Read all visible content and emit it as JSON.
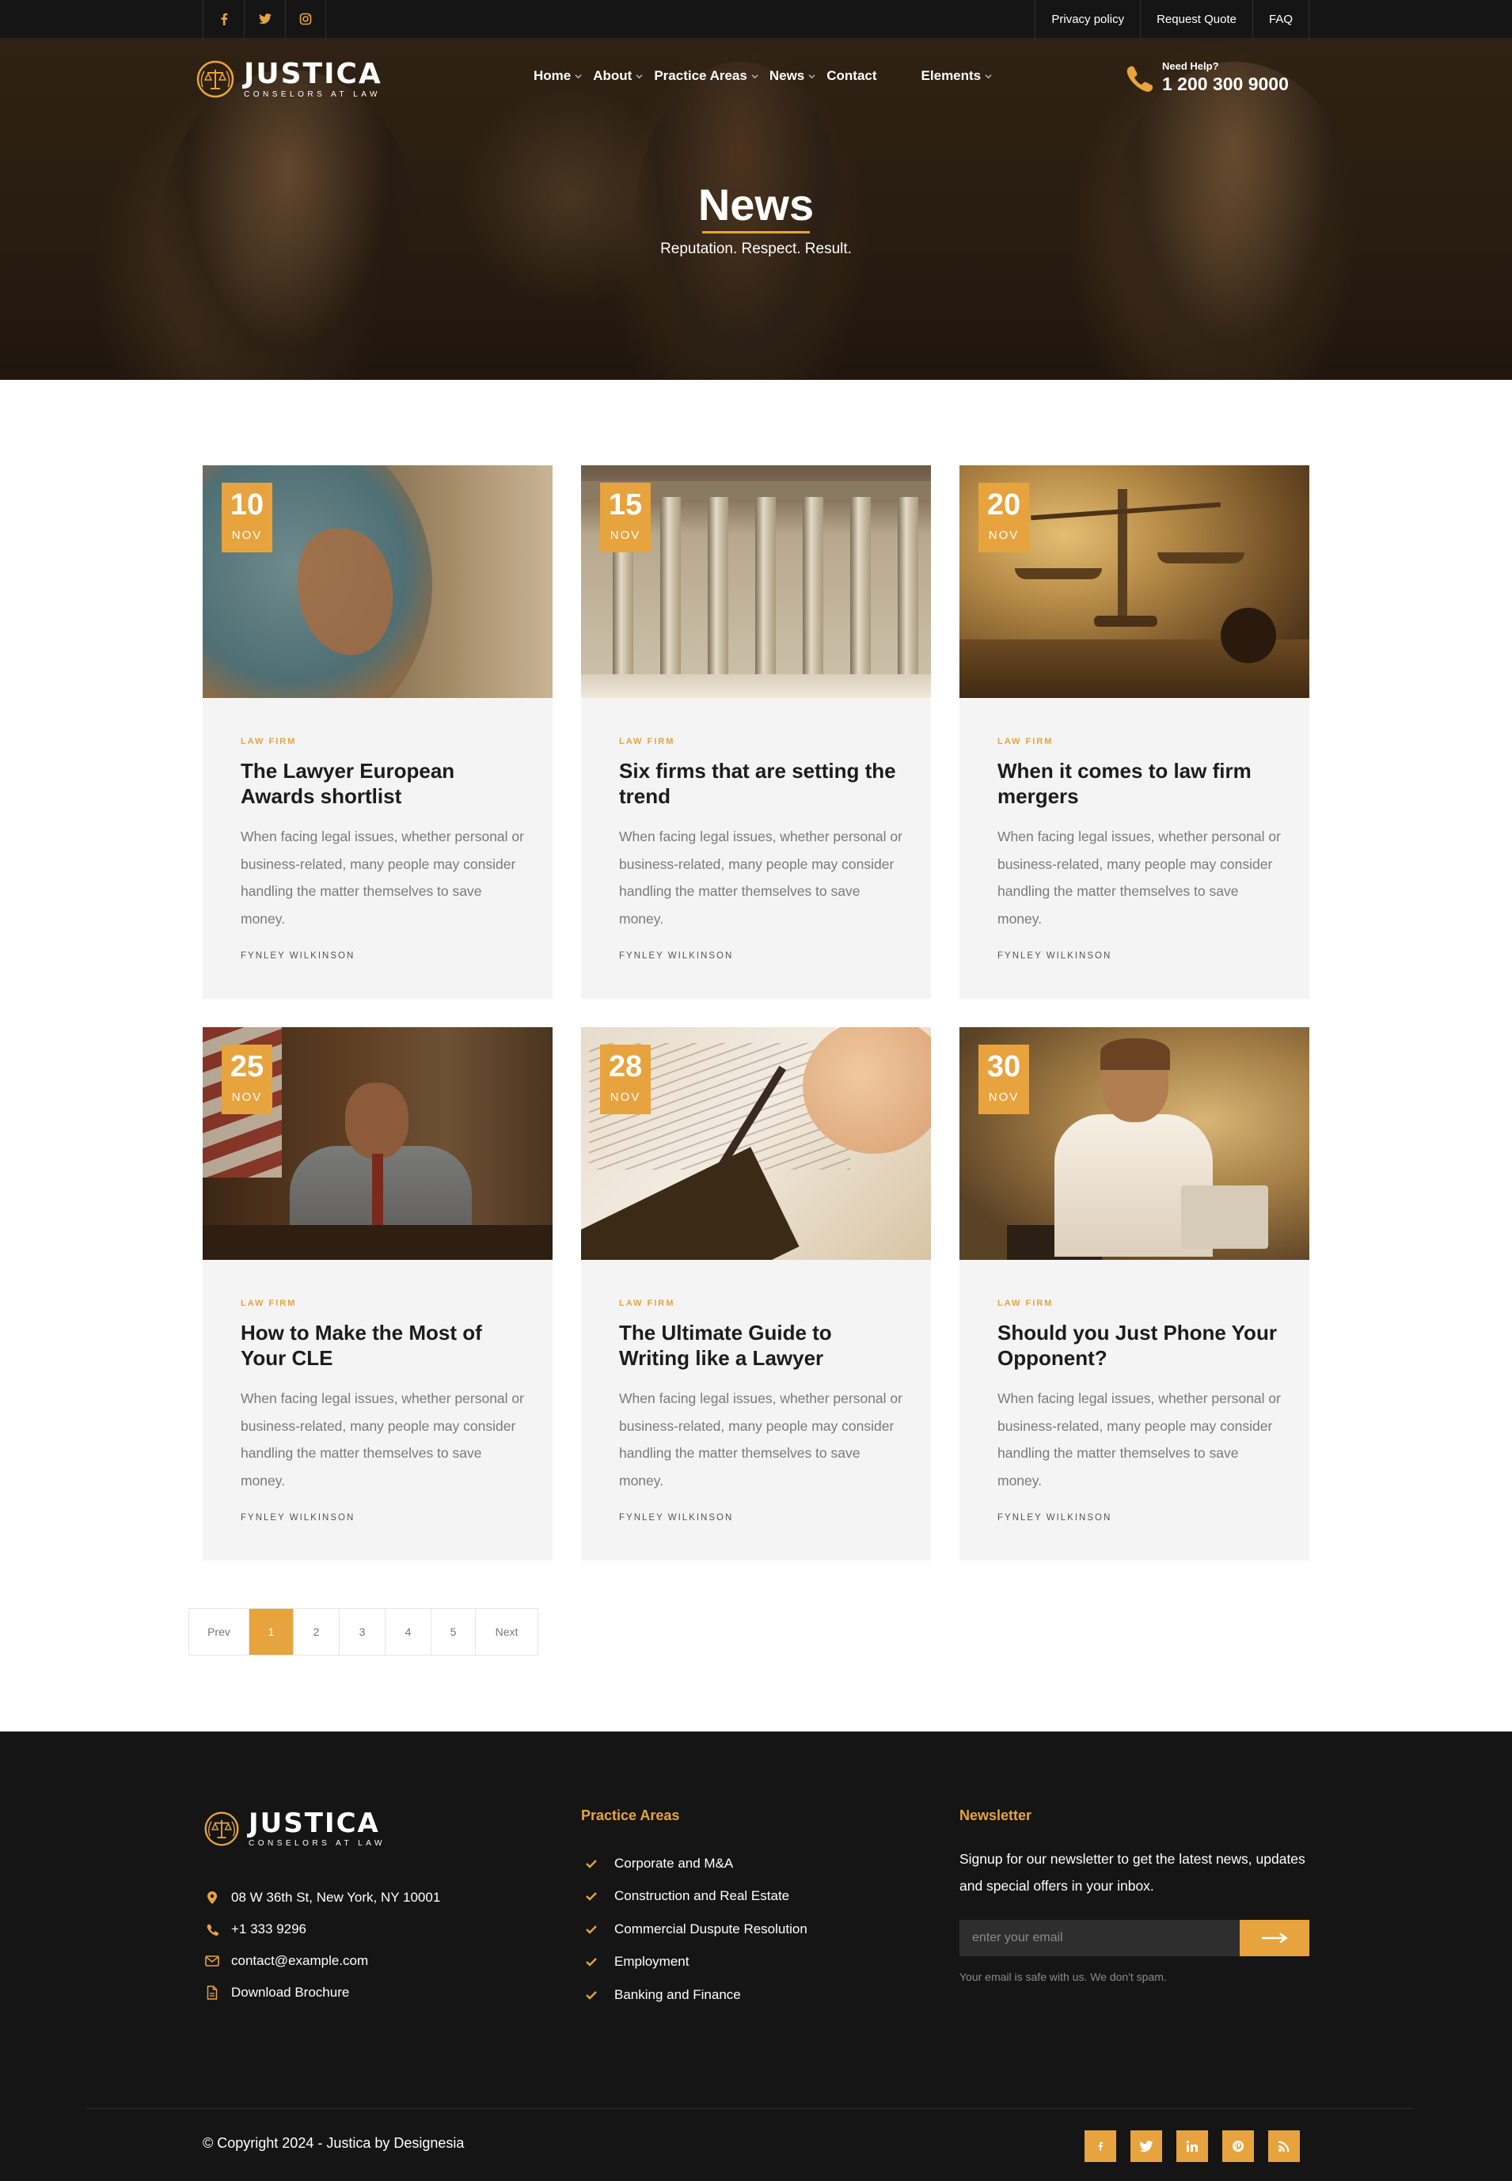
{
  "topbar": {
    "social": [
      {
        "icon": "facebook-icon",
        "glyph": "f"
      },
      {
        "icon": "twitter-icon",
        "glyph": "t"
      },
      {
        "icon": "instagram-icon",
        "glyph": "i"
      }
    ],
    "links": [
      "Privacy policy",
      "Request Quote",
      "FAQ"
    ]
  },
  "brand": {
    "name": "JUSTICA",
    "tagline": "CONSELORS AT LAW"
  },
  "nav": {
    "items": [
      {
        "label": "Home",
        "has_dropdown": true
      },
      {
        "label": "About",
        "has_dropdown": true
      },
      {
        "label": "Practice Areas",
        "has_dropdown": true
      },
      {
        "label": "News",
        "has_dropdown": true
      },
      {
        "label": "Contact",
        "has_dropdown": false
      },
      {
        "label": "Elements",
        "has_dropdown": true
      }
    ]
  },
  "help": {
    "label": "Need Help?",
    "phone": "1 200 300 9000"
  },
  "hero": {
    "title": "News",
    "subtitle": "Reputation. Respect. Result."
  },
  "posts": [
    {
      "day": "10",
      "month": "NOV",
      "category": "LAW FIRM",
      "title": "The Lawyer European Awards shortlist",
      "excerpt": "When facing legal issues, whether personal or business-related, many people may consider handling the matter themselves to save money.",
      "author": "FYNLEY WILKINSON"
    },
    {
      "day": "15",
      "month": "NOV",
      "category": "LAW FIRM",
      "title": "Six firms that are setting the trend",
      "excerpt": "When facing legal issues, whether personal or business-related, many people may consider handling the matter themselves to save money.",
      "author": "FYNLEY WILKINSON"
    },
    {
      "day": "20",
      "month": "NOV",
      "category": "LAW FIRM",
      "title": "When it comes to law firm mergers",
      "excerpt": "When facing legal issues, whether personal or business-related, many people may consider handling the matter themselves to save money.",
      "author": "FYNLEY WILKINSON"
    },
    {
      "day": "25",
      "month": "NOV",
      "category": "LAW FIRM",
      "title": "How to Make the Most of Your CLE",
      "excerpt": "When facing legal issues, whether personal or business-related, many people may consider handling the matter themselves to save money.",
      "author": "FYNLEY WILKINSON"
    },
    {
      "day": "28",
      "month": "NOV",
      "category": "LAW FIRM",
      "title": "The Ultimate Guide to Writing like a Lawyer",
      "excerpt": "When facing legal issues, whether personal or business-related, many people may consider handling the matter themselves to save money.",
      "author": "FYNLEY WILKINSON"
    },
    {
      "day": "30",
      "month": "NOV",
      "category": "LAW FIRM",
      "title": "Should you Just Phone Your Opponent?",
      "excerpt": "When facing legal issues, whether personal or business-related, many people may consider handling the matter themselves to save money.",
      "author": "FYNLEY WILKINSON"
    }
  ],
  "pagination": {
    "prev": "Prev",
    "pages": [
      "1",
      "2",
      "3",
      "4",
      "5"
    ],
    "current": "1",
    "next": "Next"
  },
  "footer": {
    "contact": [
      {
        "icon": "map-pin-icon",
        "text": "08 W 36th St, New York, NY 10001"
      },
      {
        "icon": "phone-icon",
        "text": "+1 333 9296"
      },
      {
        "icon": "envelope-icon",
        "text": "contact@example.com"
      },
      {
        "icon": "document-icon",
        "text": "Download Brochure"
      }
    ],
    "practice_title": "Practice Areas",
    "practice_areas": [
      "Corporate and M&A",
      "Construction and Real Estate",
      "Commercial Duspute Resolution",
      "Employment",
      "Banking and Finance"
    ],
    "newsletter_title": "Newsletter",
    "newsletter_text": "Signup for our newsletter to get the latest news, updates and special offers in your inbox.",
    "email_placeholder": "enter your email",
    "email_note": "Your email is safe with us. We don't spam.",
    "copyright": "© Copyright 2024 - Justica by Designesia",
    "social": [
      "facebook-icon",
      "twitter-icon",
      "linkedin-icon",
      "pinterest-icon",
      "rss-icon"
    ]
  },
  "colors": {
    "accent": "#e7a33e",
    "dark": "#151515",
    "card_bg": "#f4f4f4"
  }
}
